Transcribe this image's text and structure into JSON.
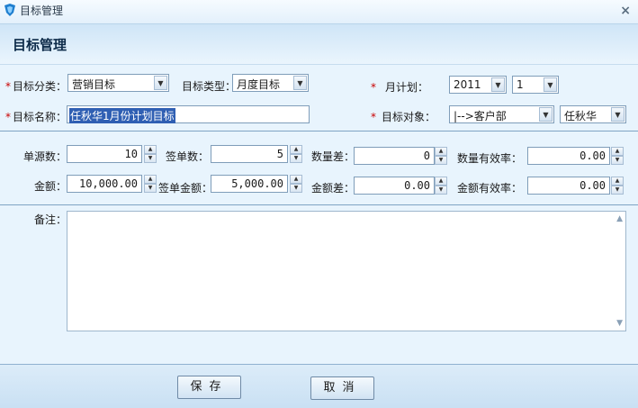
{
  "window": {
    "title": "目标管理",
    "close_glyph": "×"
  },
  "header": {
    "title": "目标管理"
  },
  "form": {
    "category": {
      "label": "目标分类：",
      "value": "营销目标"
    },
    "type": {
      "label": "目标类型：",
      "value": "月度目标"
    },
    "month_plan": {
      "label": "月计划：",
      "year": "2011",
      "month": "1"
    },
    "name": {
      "label": "目标名称：",
      "value": "任秋华1月份计划目标"
    },
    "target": {
      "label": "目标对象：",
      "dept": "|-->客户部",
      "person": "任秋华"
    },
    "required_mark": "*"
  },
  "stats": {
    "source_count": {
      "label": "单源数：",
      "value": "10"
    },
    "deal_count": {
      "label": "签单数：",
      "value": "5"
    },
    "qty_diff": {
      "label": "数量差：",
      "value": "0"
    },
    "qty_eff": {
      "label": "数量有效率：",
      "value": "0.00"
    },
    "amount": {
      "label": "金额：",
      "value": "10,000.00"
    },
    "deal_amount": {
      "label": "签单金额：",
      "value": "5,000.00"
    },
    "amount_diff": {
      "label": "金额差：",
      "value": "0.00"
    },
    "amount_eff": {
      "label": "金额有效率：",
      "value": "0.00"
    }
  },
  "remarks": {
    "label": "备注：",
    "value": ""
  },
  "buttons": {
    "save": "保存",
    "cancel": "取消"
  },
  "colors": {
    "accent": "#2f5fb3",
    "required": "#c80000",
    "background": "#e8f4fd"
  }
}
